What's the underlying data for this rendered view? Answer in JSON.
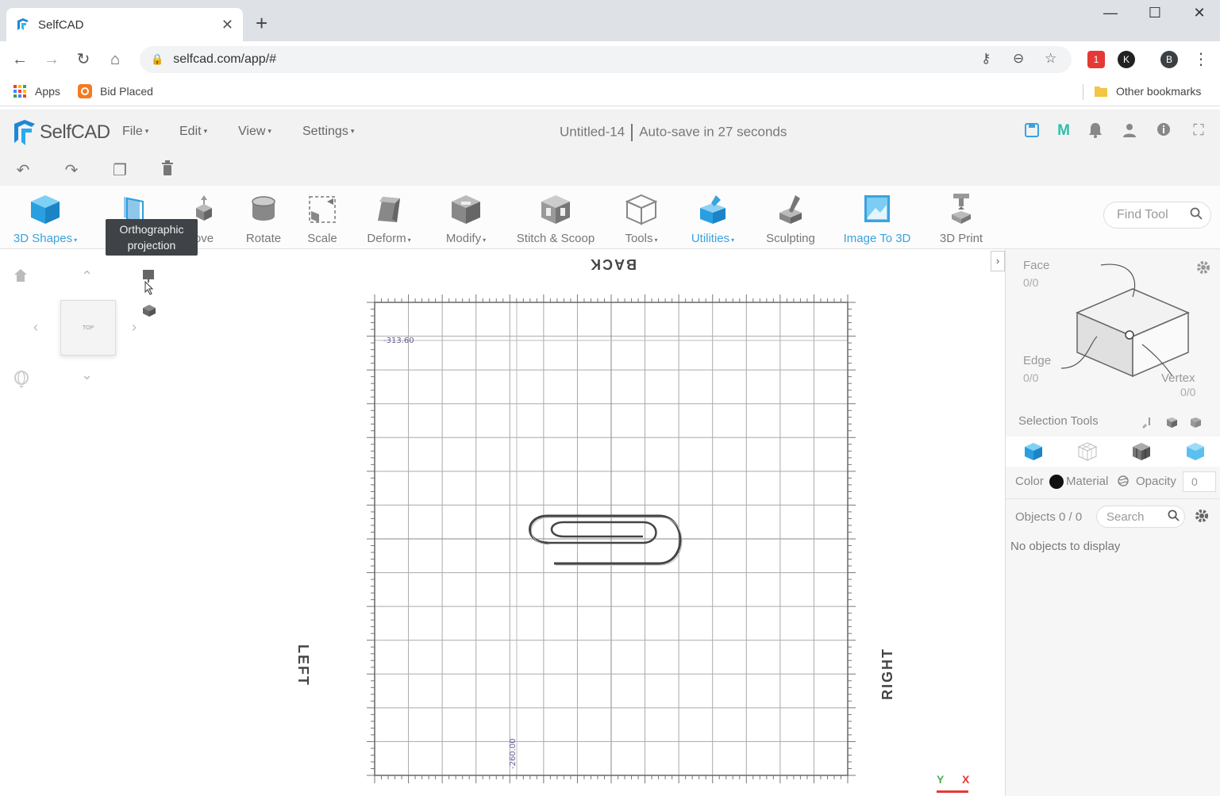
{
  "browser": {
    "tab_title": "SelfCAD",
    "tab_close": "✕",
    "new_tab": "+",
    "url": "selfcad.com/app/#",
    "window_controls": {
      "minimize": "—",
      "maximize": "☐",
      "close": "✕"
    },
    "nav": {
      "back": "←",
      "forward": "→",
      "reload": "↻",
      "home": "⌂"
    },
    "omnibox_icons": {
      "key": "⚷",
      "zoom": "⊖",
      "star": "☆"
    },
    "extensions": [
      {
        "name": "extension-red-icon",
        "label": "1",
        "color": "#e53935"
      },
      {
        "name": "extension-k-icon",
        "label": "K",
        "color": "#222222"
      },
      {
        "name": "profile-avatar",
        "label": "B",
        "color": "#3c4043"
      }
    ],
    "menu_dots": "⋮",
    "bookmarks": {
      "apps_label": "Apps",
      "bid_placed_label": "Bid Placed",
      "other_label": "Other bookmarks"
    }
  },
  "app": {
    "logo_text": "SelfCAD",
    "menus": [
      {
        "label": "File"
      },
      {
        "label": "Edit"
      },
      {
        "label": "View"
      },
      {
        "label": "Settings"
      }
    ],
    "caret": "▾",
    "doc_name": "Untitled-14",
    "autosave_text": "Auto-save in 27 seconds",
    "top_icons": {
      "save": "💾",
      "m": "M",
      "bell": "🔔",
      "user": "👤",
      "info": "ⓘ",
      "fullscreen": "⛶"
    },
    "quickbar": {
      "undo": "↶",
      "redo": "↷",
      "copy": "❐",
      "delete": "🗑"
    },
    "tools": [
      {
        "label": "3D Shapes",
        "blue": true,
        "dropdown": true
      },
      {
        "label": "ove",
        "blue": false,
        "dropdown": false
      },
      {
        "label": "Rotate",
        "blue": false,
        "dropdown": false
      },
      {
        "label": "Scale",
        "blue": false,
        "dropdown": false
      },
      {
        "label": "Deform",
        "blue": false,
        "dropdown": true
      },
      {
        "label": "Modify",
        "blue": false,
        "dropdown": true
      },
      {
        "label": "Stitch & Scoop",
        "blue": false,
        "dropdown": false
      },
      {
        "label": "Tools",
        "blue": false,
        "dropdown": true
      },
      {
        "label": "Utilities",
        "blue": true,
        "dropdown": true
      },
      {
        "label": "Sculpting",
        "blue": false,
        "dropdown": false
      },
      {
        "label": "Image To 3D",
        "blue": true,
        "dropdown": false
      },
      {
        "label": "3D Print",
        "blue": false,
        "dropdown": false
      }
    ],
    "find_tool_placeholder": "Find Tool",
    "tooltip_line1": "Orthographic",
    "tooltip_line2": "projection",
    "colors": {
      "accent": "#3ba3dd",
      "panel_bg": "#f6f6f6",
      "tooltip_bg": "#3f4347"
    }
  },
  "viewport": {
    "cube_face_label": "TOP",
    "labels": {
      "back": "BACK",
      "left": "LEFT",
      "right": "RIGHT"
    },
    "grid_top_value": "-313.60",
    "grid_bottom_value": "-260.00",
    "axes": {
      "y": "Y",
      "x": "X"
    },
    "panel_toggle": "›"
  },
  "right_panel": {
    "face_label": "Face",
    "face_value": "0/0",
    "edge_label": "Edge",
    "edge_value": "0/0",
    "vertex_label": "Vertex",
    "vertex_value": "0/0",
    "selection_tools_label": "Selection Tools",
    "color_label": "Color",
    "material_label": "Material",
    "opacity_label": "Opacity",
    "opacity_value": "0",
    "objects_label": "Objects 0 / 0",
    "search_placeholder": "Search",
    "no_objects_text": "No objects to display"
  }
}
